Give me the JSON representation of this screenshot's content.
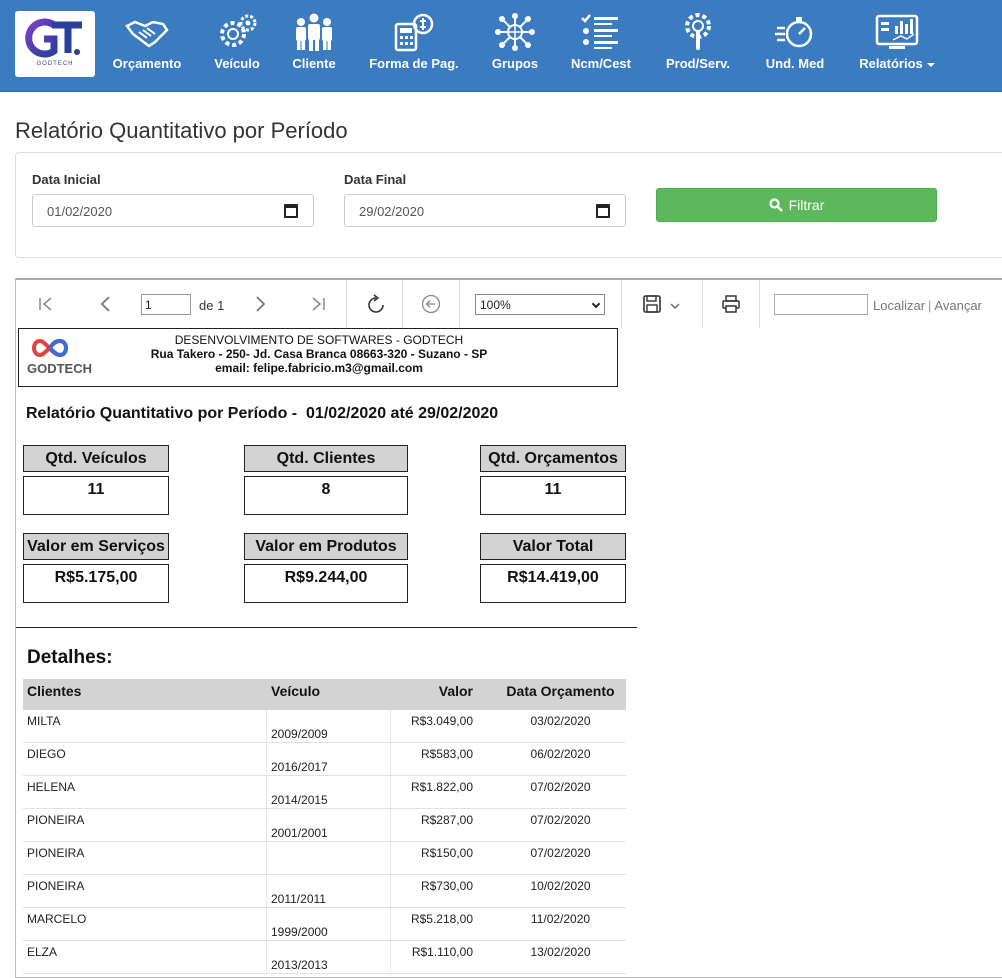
{
  "brand": {
    "logo_text": "GT",
    "logo_subtitle": "GODTECH"
  },
  "nav": [
    {
      "label": "Orçamento",
      "icon": "handshake-icon"
    },
    {
      "label": "Veículo",
      "icon": "gears-icon"
    },
    {
      "label": "Cliente",
      "icon": "people-icon"
    },
    {
      "label": "Forma de Pag.",
      "icon": "calculator-icon"
    },
    {
      "label": "Grupos",
      "icon": "network-globe-icon"
    },
    {
      "label": "Ncm/Cest",
      "icon": "checklist-icon"
    },
    {
      "label": "Prod/Serv.",
      "icon": "wrench-gear-icon"
    },
    {
      "label": "Und. Med",
      "icon": "stopwatch-icon"
    },
    {
      "label": "Relatórios",
      "icon": "report-chart-icon"
    }
  ],
  "page": {
    "title": "Relatório Quantitativo por Período"
  },
  "filter": {
    "start_label": "Data Inicial",
    "start_value": "01/02/2020",
    "end_label": "Data Final",
    "end_value": "29/02/2020",
    "button_label": "Filtrar"
  },
  "viewer": {
    "page_current": "1",
    "page_of": "de 1",
    "zoom": "100%",
    "find_label": "Localizar",
    "next_label": "Avançar"
  },
  "report": {
    "logo_text": "GODTECH",
    "company_name": "DESENVOLVIMENTO DE SOFTWARES - GODTECH",
    "company_address": "Rua Takero - 250- Jd. Casa Branca 08663-320 - Suzano - SP",
    "company_email": "email: felipe.fabricio.m3@gmail.com",
    "title": "Relatório Quantitativo por Período -  01/02/2020 até 29/02/2020",
    "stats": {
      "veiculos_label": "Qtd. Veículos",
      "veiculos_value": "11",
      "clientes_label": "Qtd. Clientes",
      "clientes_value": "8",
      "orcamentos_label": "Qtd. Orçamentos",
      "orcamentos_value": "11",
      "servicos_label": "Valor em Serviços",
      "servicos_value": "R$5.175,00",
      "produtos_label": "Valor em Produtos",
      "produtos_value": "R$9.244,00",
      "total_label": "Valor Total",
      "total_value": "R$14.419,00"
    },
    "details_label": "Detalhes:",
    "columns": [
      "Clientes",
      "Veículo",
      "Valor",
      "Data Orçamento"
    ],
    "rows": [
      [
        "MILTA",
        "2009/2009",
        "R$3.049,00",
        "03/02/2020"
      ],
      [
        "DIEGO",
        "2016/2017",
        "R$583,00",
        "06/02/2020"
      ],
      [
        "HELENA",
        "2014/2015",
        "R$1.822,00",
        "07/02/2020"
      ],
      [
        "PIONEIRA",
        "2001/2001",
        "R$287,00",
        "07/02/2020"
      ],
      [
        "PIONEIRA",
        "",
        "R$150,00",
        "07/02/2020"
      ],
      [
        "PIONEIRA",
        "2011/2011",
        "R$730,00",
        "10/02/2020"
      ],
      [
        "MARCELO",
        "1999/2000",
        "R$5.218,00",
        "11/02/2020"
      ],
      [
        "ELZA",
        "2013/2013",
        "R$1.110,00",
        "13/02/2020"
      ]
    ]
  }
}
